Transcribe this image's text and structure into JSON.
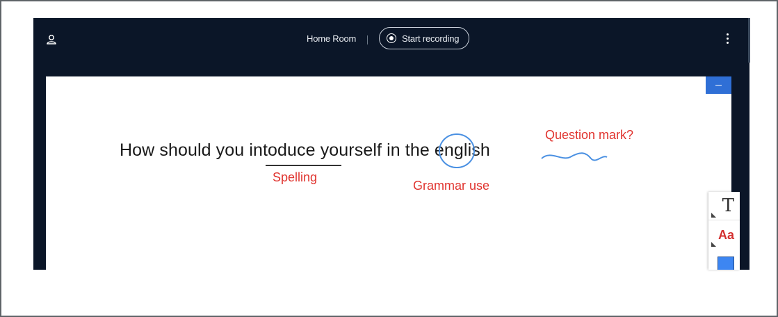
{
  "header": {
    "room_name": "Home Room",
    "record_label": "Start recording"
  },
  "icons": {
    "user": "user-icon",
    "record": "record-icon",
    "more": "more-vertical-icon",
    "minimize": "minimize-icon",
    "text_tool": "text-tool-icon",
    "font_tool": "font-style-icon",
    "color": "color-swatch"
  },
  "whiteboard": {
    "sentence": {
      "part1": "How should you ",
      "word_intoduce": "intoduce",
      "part2": " yourself in ",
      "word_the": "the",
      "part3": " english"
    },
    "annotations": {
      "spelling": "Spelling",
      "grammar": "Grammar use",
      "question": "Question mark?"
    },
    "annotation_color": "#e0332e",
    "ink_color": "#4a90e2"
  },
  "tools": {
    "text_glyph": "T",
    "font_glyph": "Aa",
    "selected_color": "#3d86f2"
  }
}
